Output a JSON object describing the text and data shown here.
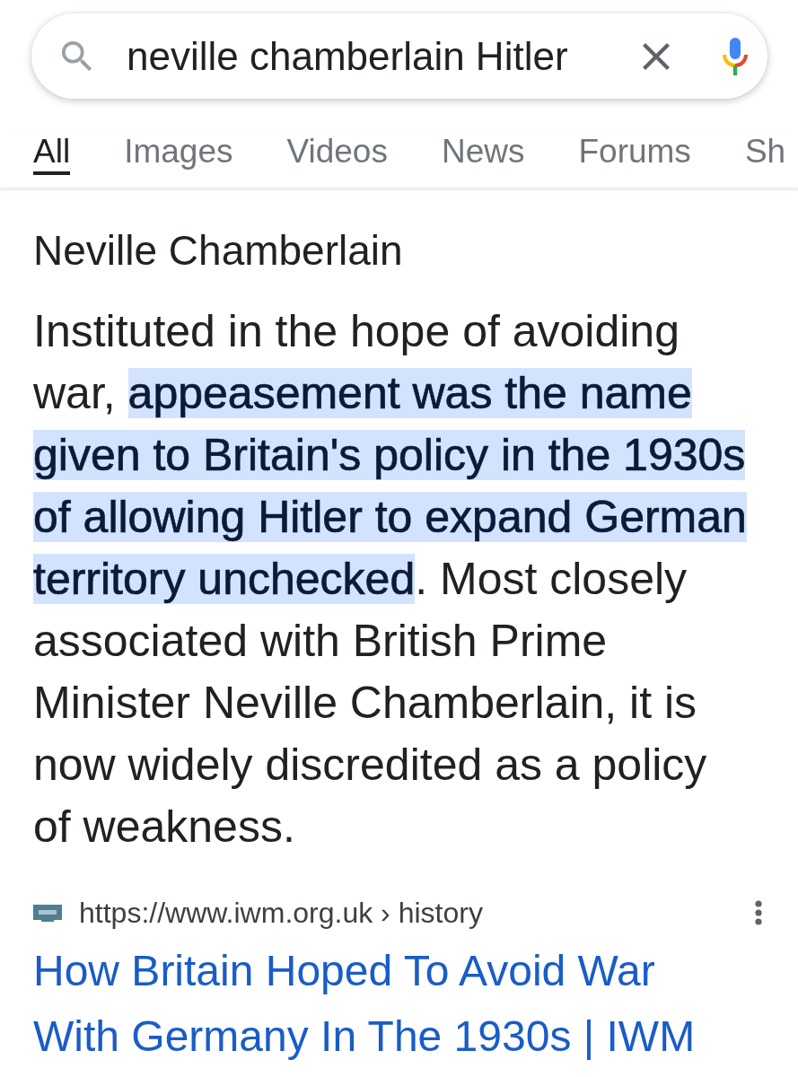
{
  "search": {
    "value": "neville chamberlain Hitler"
  },
  "tabs": [
    {
      "label": "All",
      "selected": true
    },
    {
      "label": "Images",
      "selected": false
    },
    {
      "label": "Videos",
      "selected": false
    },
    {
      "label": "News",
      "selected": false
    },
    {
      "label": "Forums",
      "selected": false
    },
    {
      "label": "Sh",
      "selected": false
    }
  ],
  "result": {
    "heading": "Neville Chamberlain",
    "snippet": "Instituted in the hope of avoiding war, **appeasement was the name given to Britain's policy in the 1930s of allowing Hitler to expand German territory unchecked**. Most closely associated with British Prime Minister Neville Chamberlain, it is now widely discredited as a policy of weakness.",
    "url": "https://www.iwm.org.uk › history",
    "title": "How Britain Hoped To Avoid War With Germany In The 1930s | IWM"
  }
}
